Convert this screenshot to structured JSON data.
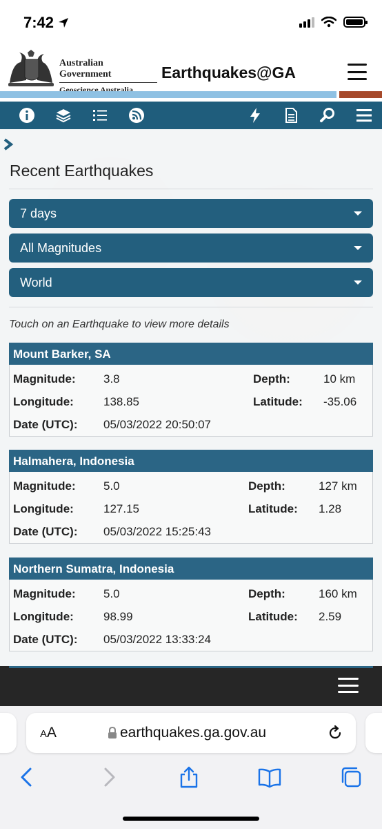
{
  "status_bar": {
    "time": "7:42"
  },
  "header": {
    "govt_line1": "Australian Government",
    "govt_line2": "Geoscience Australia",
    "brand": "Earthquakes@GA"
  },
  "toolbar": {
    "icons": [
      "info-icon",
      "layers-icon",
      "list-icon",
      "rss-icon",
      "lightning-icon",
      "document-icon",
      "search-icon",
      "menu-icon"
    ]
  },
  "page": {
    "title": "Recent Earthquakes",
    "filters": {
      "period": "7 days",
      "magnitude": "All Magnitudes",
      "region": "World"
    },
    "hint": "Touch on an Earthquake to view more details"
  },
  "labels": {
    "magnitude": "Magnitude:",
    "depth": "Depth:",
    "longitude": "Longitude:",
    "latitude": "Latitude:",
    "date": "Date (UTC):"
  },
  "earthquakes": [
    {
      "place": "Mount Barker, SA",
      "magnitude": "3.8",
      "depth": "10 km",
      "longitude": "138.85",
      "latitude": "-35.06",
      "date": "05/03/2022 20:50:07"
    },
    {
      "place": "Halmahera, Indonesia",
      "magnitude": "5.0",
      "depth": "127 km",
      "longitude": "127.15",
      "latitude": "1.28",
      "date": "05/03/2022 15:25:43"
    },
    {
      "place": "Northern Sumatra, Indonesia",
      "magnitude": "5.0",
      "depth": "160 km",
      "longitude": "98.99",
      "latitude": "2.59",
      "date": "05/03/2022 13:33:24"
    }
  ],
  "browser": {
    "text_size": "AA",
    "url": "earthquakes.ga.gov.au"
  },
  "colors": {
    "primary": "#235f7e",
    "card_header": "#2b6585",
    "stripe_blue": "#8fc1e3",
    "stripe_brown": "#a6492a",
    "footer": "#262626"
  }
}
